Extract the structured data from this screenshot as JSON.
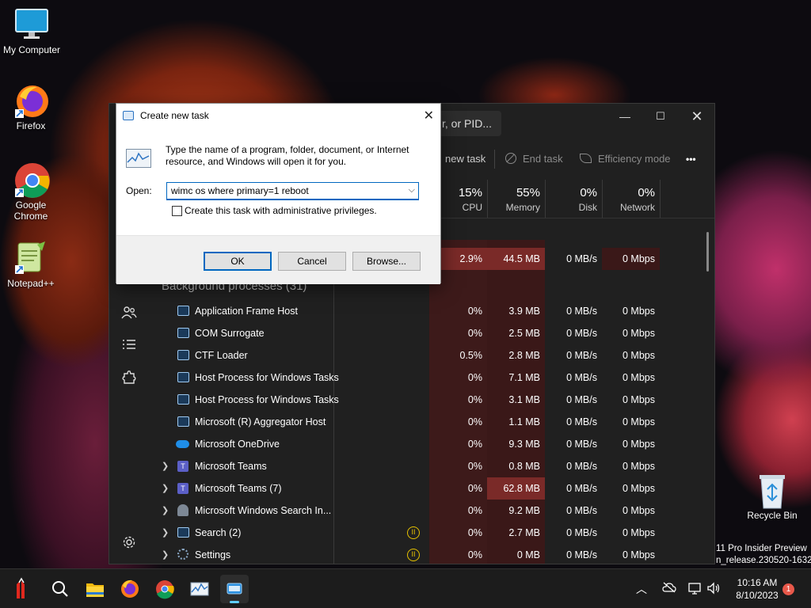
{
  "desktop": {
    "icons": [
      {
        "label": "My Computer"
      },
      {
        "label": "Firefox"
      },
      {
        "label": "Google Chrome"
      },
      {
        "label": "Notepad++"
      },
      {
        "label": "Recycle Bin"
      }
    ],
    "watermark": [
      "11 Pro Insider Preview",
      "n_release.230520-1632"
    ]
  },
  "task_manager": {
    "search_text": "r, or PID...",
    "commands": {
      "run_new_task": "new task",
      "end_task": "End task",
      "efficiency_mode": "Efficiency mode",
      "more": "•••"
    },
    "columns": [
      {
        "pct": "15%",
        "label": "CPU"
      },
      {
        "pct": "55%",
        "label": "Memory"
      },
      {
        "pct": "0%",
        "label": "Disk"
      },
      {
        "pct": "0%",
        "label": "Network"
      }
    ],
    "top_row": {
      "cpu": "2.9%",
      "memory": "44.5 MB",
      "disk": "0 MB/s",
      "network": "0 Mbps"
    },
    "section_label": "Background processes (31)",
    "processes": [
      {
        "name": "Application Frame Host",
        "cpu": "0%",
        "memory": "3.9 MB",
        "disk": "0 MB/s",
        "network": "0 Mbps"
      },
      {
        "name": "COM Surrogate",
        "cpu": "0%",
        "memory": "2.5 MB",
        "disk": "0 MB/s",
        "network": "0 Mbps"
      },
      {
        "name": "CTF Loader",
        "cpu": "0.5%",
        "memory": "2.8 MB",
        "disk": "0 MB/s",
        "network": "0 Mbps"
      },
      {
        "name": "Host Process for Windows Tasks",
        "cpu": "0%",
        "memory": "7.1 MB",
        "disk": "0 MB/s",
        "network": "0 Mbps"
      },
      {
        "name": "Host Process for Windows Tasks",
        "cpu": "0%",
        "memory": "3.1 MB",
        "disk": "0 MB/s",
        "network": "0 Mbps"
      },
      {
        "name": "Microsoft (R) Aggregator Host",
        "cpu": "0%",
        "memory": "1.1 MB",
        "disk": "0 MB/s",
        "network": "0 Mbps"
      },
      {
        "name": "Microsoft OneDrive",
        "cpu": "0%",
        "memory": "9.3 MB",
        "disk": "0 MB/s",
        "network": "0 Mbps"
      },
      {
        "name": "Microsoft Teams",
        "cpu": "0%",
        "memory": "0.8 MB",
        "disk": "0 MB/s",
        "network": "0 Mbps"
      },
      {
        "name": "Microsoft Teams (7)",
        "cpu": "0%",
        "memory": "62.8 MB",
        "disk": "0 MB/s",
        "network": "0 Mbps"
      },
      {
        "name": "Microsoft Windows Search In...",
        "cpu": "0%",
        "memory": "9.2 MB",
        "disk": "0 MB/s",
        "network": "0 Mbps"
      },
      {
        "name": "Search (2)",
        "cpu": "0%",
        "memory": "2.7 MB",
        "disk": "0 MB/s",
        "network": "0 Mbps"
      },
      {
        "name": "Settings",
        "cpu": "0%",
        "memory": "0 MB",
        "disk": "0 MB/s",
        "network": "0 Mbps"
      }
    ]
  },
  "dialog": {
    "title": "Create new task",
    "description": "Type the name of a program, folder, document, or Internet resource, and Windows will open it for you.",
    "open_label": "Open:",
    "open_value": "wimc os where primary=1 reboot",
    "admin_checkbox_label": "Create this task with administrative privileges.",
    "admin_checked": false,
    "ok": "OK",
    "cancel": "Cancel",
    "browse": "Browse..."
  },
  "taskbar": {
    "time": "10:16 AM",
    "date": "8/10/2023",
    "notification_count": "1"
  }
}
